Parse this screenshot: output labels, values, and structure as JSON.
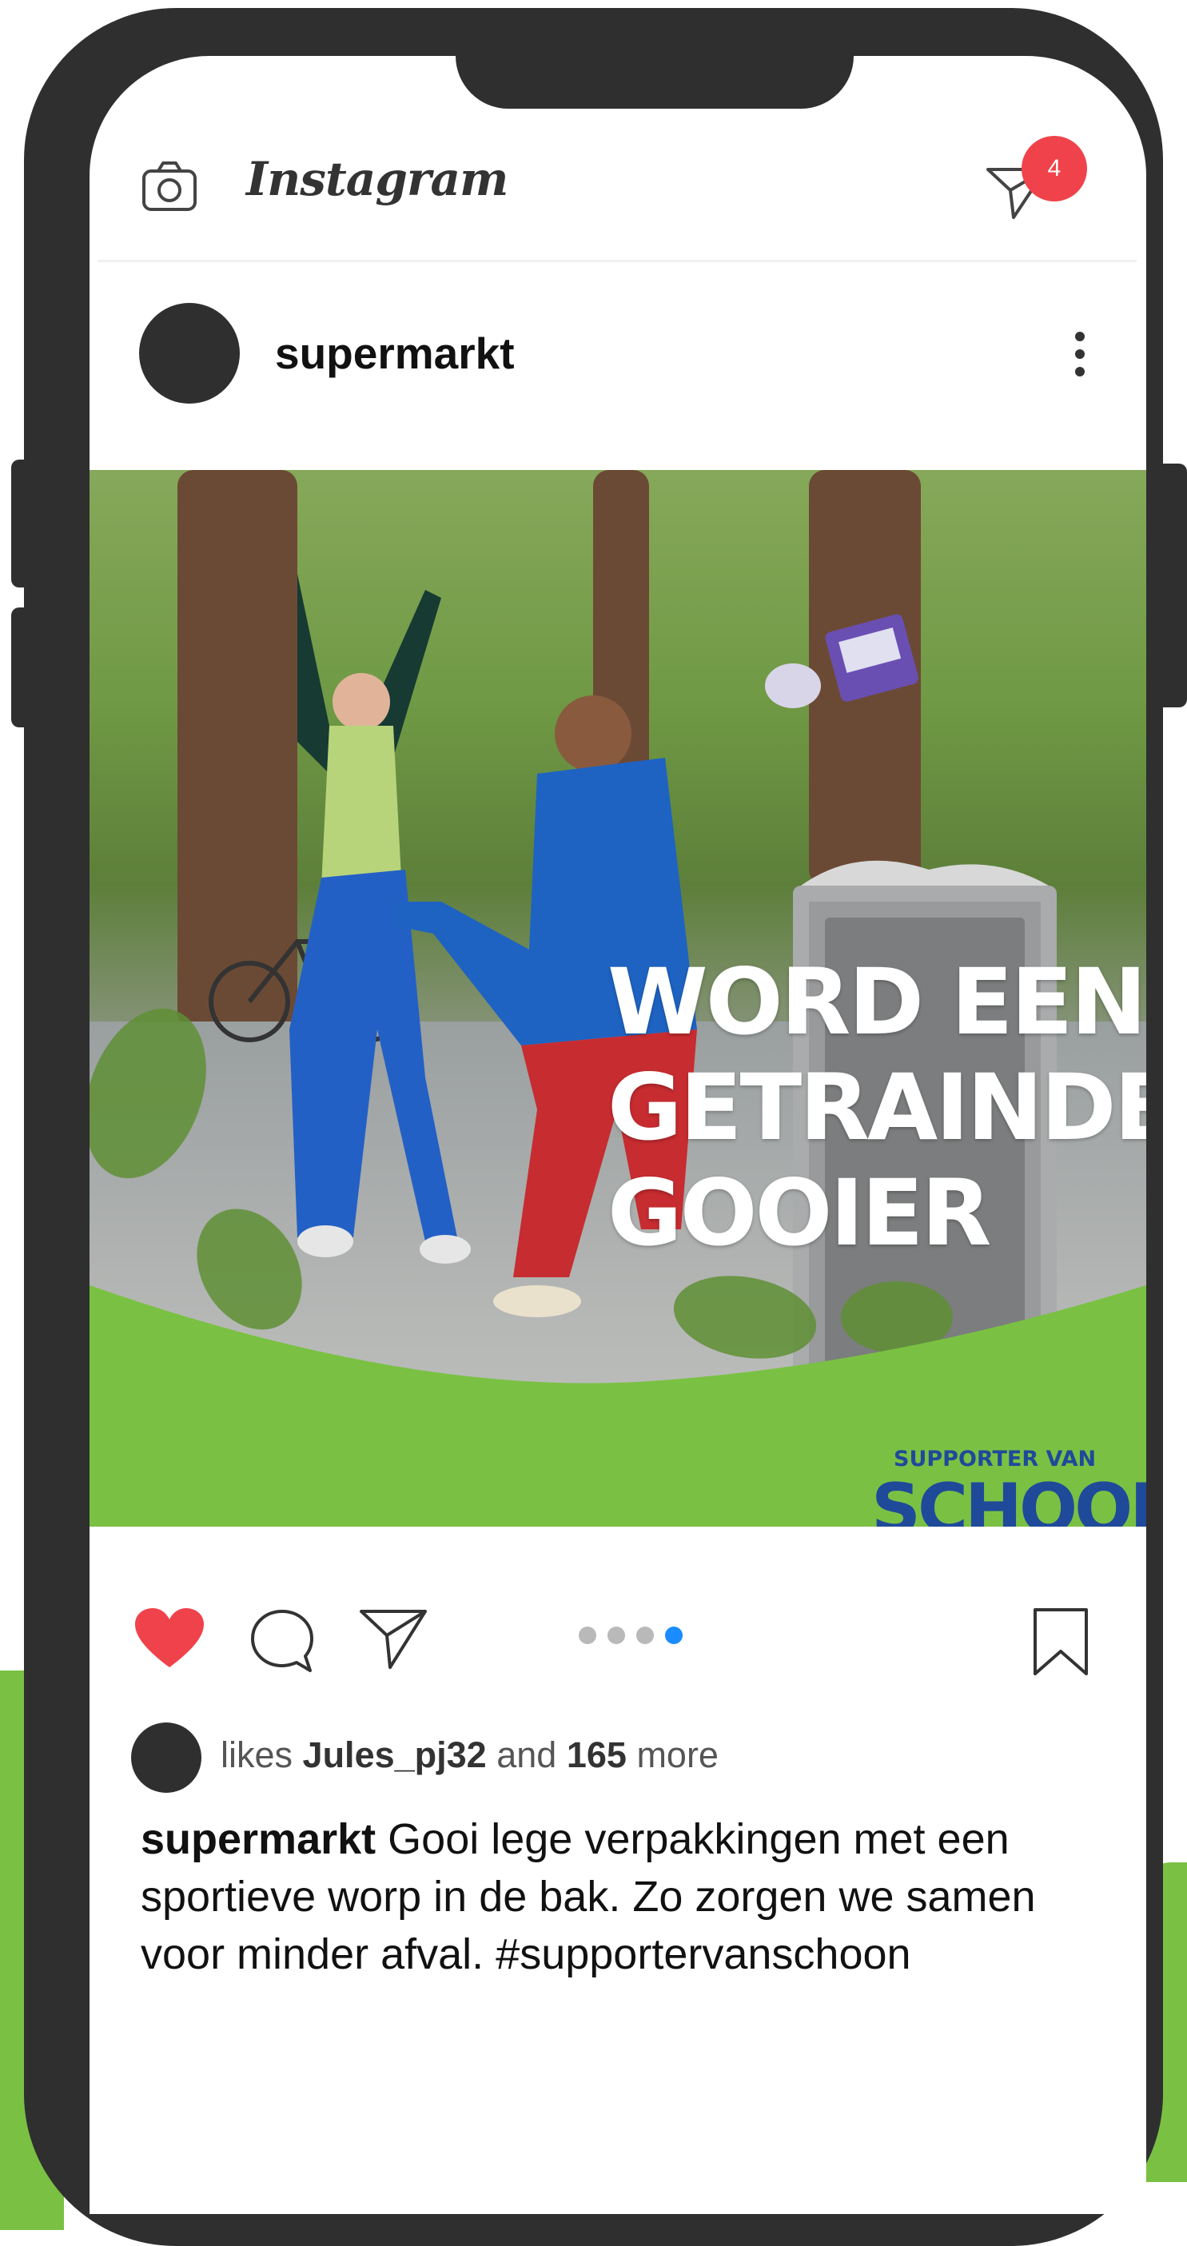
{
  "app": {
    "logo_text": "Instagram",
    "notification_count": "4"
  },
  "post": {
    "username": "supermarkt",
    "headline": [
      "WORD EEN",
      "GETRAINDE",
      "GOOIER"
    ],
    "brand_top": "SUPPORTER VAN",
    "brand_main": "SCHOON",
    "carousel": {
      "total": 4,
      "active_index": 3
    },
    "liked": true
  },
  "likes": {
    "prefix": "likes",
    "user": "Jules_pj32",
    "middle": "and",
    "count": "165",
    "suffix": "more"
  },
  "caption": {
    "username": "supermarkt",
    "text": "Gooi lege verpakkingen met een sportieve worp in de bak. Zo zorgen we samen voor minder afval. #supportervanschoon"
  },
  "colors": {
    "heart": "#f0424a",
    "badge": "#f0424a",
    "brand_green": "#7ac143",
    "brand_blue": "#1f4a9a",
    "carousel_active": "#1a8cff"
  },
  "icons": [
    "camera-icon",
    "direct-message-icon",
    "more-options-icon",
    "heart-icon",
    "comment-icon",
    "share-icon",
    "bookmark-icon"
  ]
}
